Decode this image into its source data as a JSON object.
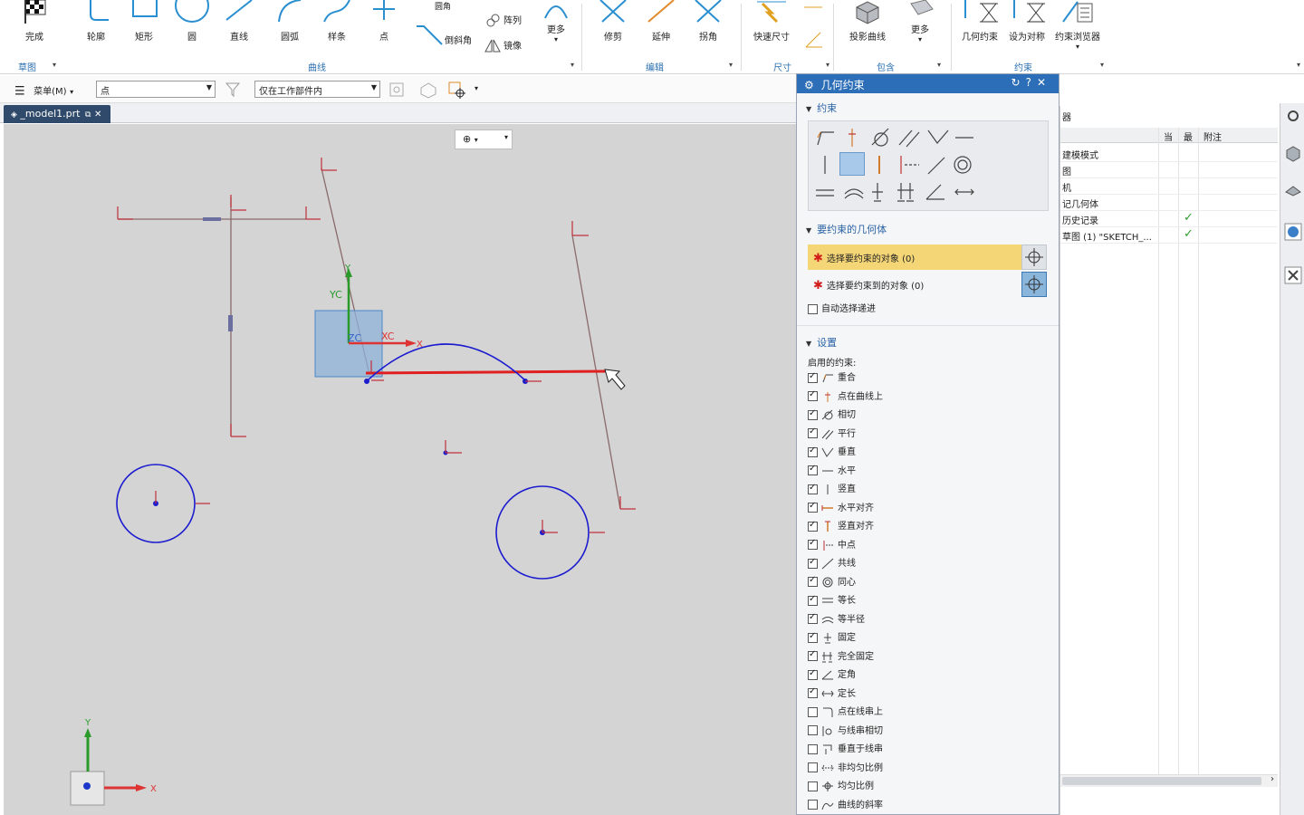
{
  "ribbon": {
    "buttons": {
      "finish": "完成",
      "profile": "轮廓",
      "rectangle": "矩形",
      "circle": "圆",
      "line": "直线",
      "arc": "圆弧",
      "spline": "样条",
      "point": "点",
      "fillet": "圆角",
      "chamfer": "倒斜角",
      "array": "阵列",
      "mirror": "镜像",
      "more_curve": "更多",
      "trim": "修剪",
      "extend": "延伸",
      "corner": "拐角",
      "rapid_dim": "快速尺寸",
      "project_curve": "投影曲线",
      "more_include": "更多",
      "geo_constraint": "几何约束",
      "set_symmetric": "设为对称",
      "constraint_browser": "约束浏览器"
    },
    "groups": {
      "sketch": "草图",
      "curve": "曲线",
      "edit": "编辑",
      "dimension": "尺寸",
      "include": "包含",
      "constraint": "约束"
    }
  },
  "toolbar": {
    "menu_label": "菜单(M)",
    "filter_value": "点",
    "scope_value": "仅在工作部件内"
  },
  "tab": {
    "filename": "_model1.prt"
  },
  "canvas": {
    "labels": {
      "yc": "YC",
      "xc": "XC",
      "zc": "ZC",
      "y_short": "Y",
      "x_short": "X",
      "triad_y": "Y",
      "triad_x": "X"
    }
  },
  "dialog": {
    "title": "几何约束",
    "section_constraint": "约束",
    "section_geometry": "要约束的几何体",
    "select_object": "选择要约束的对象 (0)",
    "select_target": "选择要约束到的对象 (0)",
    "auto_advance": "自动选择递进",
    "section_settings": "设置",
    "enabled_constraints": "启用的约束:",
    "constraints": [
      {
        "label": "重合",
        "checked": true,
        "icon": "coincident-icon"
      },
      {
        "label": "点在曲线上",
        "checked": true,
        "icon": "point-on-curve-icon"
      },
      {
        "label": "相切",
        "checked": true,
        "icon": "tangent-icon"
      },
      {
        "label": "平行",
        "checked": true,
        "icon": "parallel-icon"
      },
      {
        "label": "垂直",
        "checked": true,
        "icon": "perpendicular-icon"
      },
      {
        "label": "水平",
        "checked": true,
        "icon": "horizontal-icon"
      },
      {
        "label": "竖直",
        "checked": true,
        "icon": "vertical-icon"
      },
      {
        "label": "水平对齐",
        "checked": true,
        "icon": "horizontal-align-icon"
      },
      {
        "label": "竖直对齐",
        "checked": true,
        "icon": "vertical-align-icon"
      },
      {
        "label": "中点",
        "checked": true,
        "icon": "midpoint-icon"
      },
      {
        "label": "共线",
        "checked": true,
        "icon": "collinear-icon"
      },
      {
        "label": "同心",
        "checked": true,
        "icon": "concentric-icon"
      },
      {
        "label": "等长",
        "checked": true,
        "icon": "equal-length-icon"
      },
      {
        "label": "等半径",
        "checked": true,
        "icon": "equal-radius-icon"
      },
      {
        "label": "固定",
        "checked": true,
        "icon": "fixed-icon"
      },
      {
        "label": "完全固定",
        "checked": true,
        "icon": "fully-fixed-icon"
      },
      {
        "label": "定角",
        "checked": true,
        "icon": "constant-angle-icon"
      },
      {
        "label": "定长",
        "checked": true,
        "icon": "constant-length-icon"
      },
      {
        "label": "点在线串上",
        "checked": false,
        "icon": "point-on-string-icon"
      },
      {
        "label": "与线串相切",
        "checked": false,
        "icon": "tangent-to-string-icon"
      },
      {
        "label": "垂直于线串",
        "checked": false,
        "icon": "perpendicular-to-string-icon"
      },
      {
        "label": "非均匀比例",
        "checked": false,
        "icon": "non-uniform-scale-icon"
      },
      {
        "label": "均匀比例",
        "checked": false,
        "icon": "uniform-scale-icon"
      },
      {
        "label": "曲线的斜率",
        "checked": false,
        "icon": "curve-slope-icon"
      }
    ]
  },
  "navigator": {
    "title_fragment": "器",
    "columns": {
      "current": "当",
      "latest": "最",
      "note": "附注"
    },
    "rows": [
      {
        "name": "建模模式",
        "latest_ok": false
      },
      {
        "name": "图",
        "latest_ok": false
      },
      {
        "name": "机",
        "latest_ok": false
      },
      {
        "name": "记几何体",
        "latest_ok": false
      },
      {
        "name": "历史记录",
        "latest_ok": true
      },
      {
        "name": "草图 (1) \"SKETCH_...",
        "latest_ok": true
      }
    ],
    "check_color": "#2ca02c"
  },
  "colors": {
    "accent": "#2c6eb7",
    "sketch_red": "#e02020",
    "curve_blue": "#1c1ccf",
    "line_brown": "#8a6a6a"
  }
}
